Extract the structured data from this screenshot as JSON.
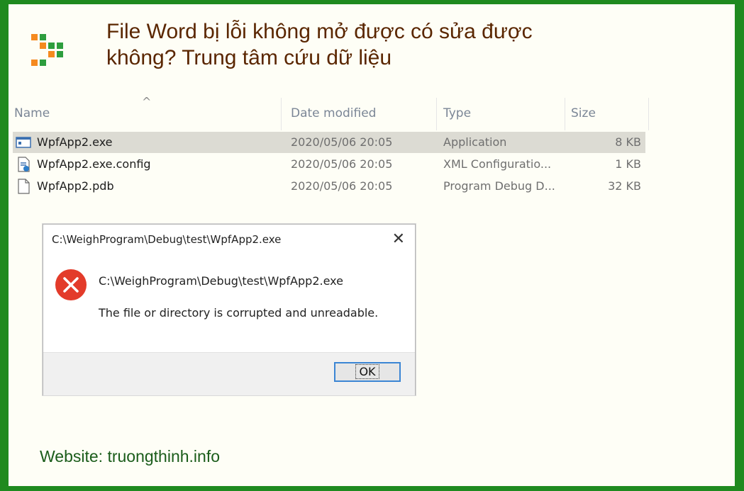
{
  "headline": {
    "line1": "File Word bị lỗi không mở được có sửa được",
    "line2": "không? Trung tâm cứu dữ liệu"
  },
  "logo": {
    "icon": "pixel-arrow-logo",
    "colors": [
      "#f58a1f",
      "#2e9e3e"
    ]
  },
  "explorer": {
    "columns": {
      "name": "Name",
      "date_modified": "Date modified",
      "type": "Type",
      "size": "Size"
    },
    "sort_indicator": "^",
    "files": [
      {
        "name": "WpfApp2.exe",
        "date": "2020/05/06 20:05",
        "type": "Application",
        "size": "8 KB",
        "icon": "application-icon",
        "selected": true
      },
      {
        "name": "WpfApp2.exe.config",
        "date": "2020/05/06 20:05",
        "type": "XML Configuratio...",
        "size": "1 KB",
        "icon": "config-file-icon",
        "selected": false
      },
      {
        "name": "WpfApp2.pdb",
        "date": "2020/05/06 20:05",
        "type": "Program Debug D...",
        "size": "32 KB",
        "icon": "blank-file-icon",
        "selected": false
      }
    ]
  },
  "dialog": {
    "title": "C:\\WeighProgram\\Debug\\test\\WpfApp2.exe",
    "path": "C:\\WeighProgram\\Debug\\test\\WpfApp2.exe",
    "message": "The file or directory is corrupted and unreadable.",
    "ok_label": "OK",
    "close_glyph": "✕",
    "error_color": "#e33b2a"
  },
  "footer": {
    "website": "Website: truongthinh.info"
  },
  "colors": {
    "border": "#1f8a1f",
    "headline": "#5a2600",
    "selection": "#dcdbd3"
  }
}
